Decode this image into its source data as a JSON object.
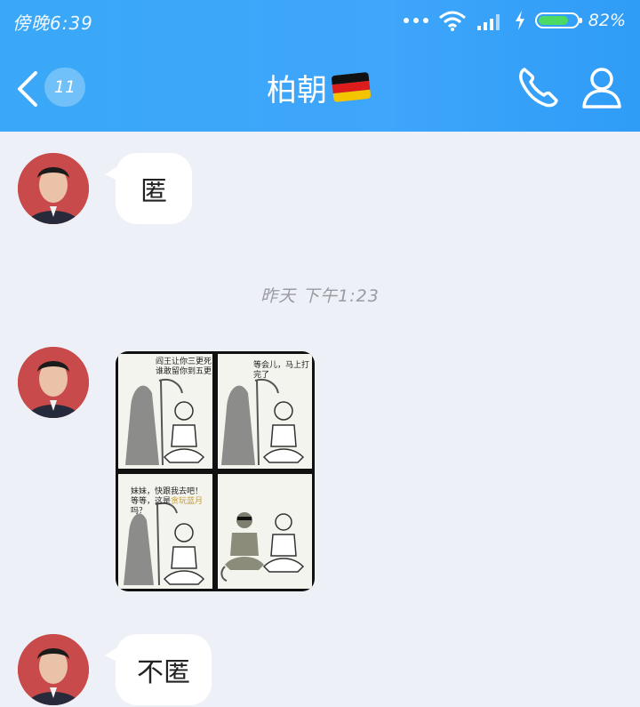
{
  "status_bar": {
    "time": "傍晚6:39",
    "battery_percent": "82%",
    "battery_level": 0.82,
    "icons": [
      "more-dots-icon",
      "wifi-icon",
      "signal-icon",
      "charging-icon",
      "battery-icon"
    ]
  },
  "nav_bar": {
    "back_icon": "chevron-left-icon",
    "unread_count": "11",
    "title": "柏朝",
    "title_emoji": "german-flag-icon",
    "actions": [
      "phone-call-icon",
      "profile-icon"
    ]
  },
  "messages": [
    {
      "type": "text",
      "sender": "other",
      "text": "匿"
    },
    {
      "type": "timestamp",
      "text": "昨天 下午1:23"
    },
    {
      "type": "image",
      "sender": "other",
      "image": "grim-reaper-comic-meme",
      "captions": [
        "阎王让你三更死\n谁敢留你到五更",
        "等会儿，马上打完了",
        "妹妹，快跟我去吧！\n等等，这是",
        "贪玩蓝月",
        "吗？"
      ]
    },
    {
      "type": "text",
      "sender": "other",
      "text": "不匿"
    }
  ],
  "colors": {
    "header_blue": "#3ea6fb",
    "chat_background": "#eef0f7",
    "bubble": "#ffffff",
    "battery_green": "#4cd964"
  }
}
